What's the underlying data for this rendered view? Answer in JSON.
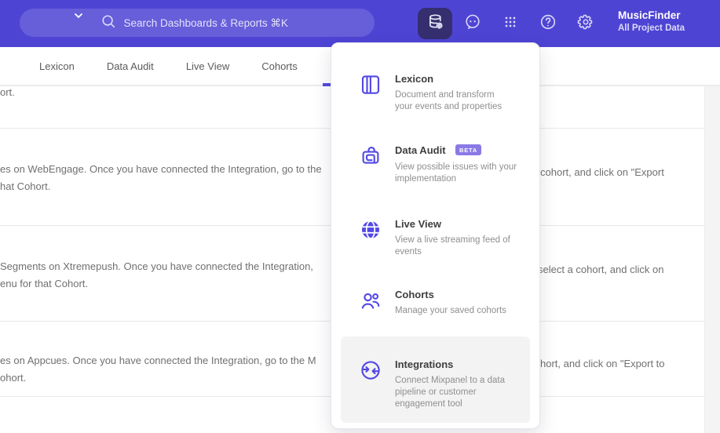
{
  "topbar": {
    "search_placeholder": "Search Dashboards & Reports ⌘K",
    "project_name": "MusicFinder",
    "project_subtitle": "All Project Data"
  },
  "tabs": {
    "items": [
      {
        "label": "Lexicon"
      },
      {
        "label": "Data Audit"
      },
      {
        "label": "Live View"
      },
      {
        "label": "Cohorts"
      }
    ]
  },
  "menu": {
    "items": [
      {
        "title": "Lexicon",
        "description": "Document and transform\nyour events and properties"
      },
      {
        "title": "Data Audit",
        "badge": "BETA",
        "description": "View possible issues with your\nimplementation"
      },
      {
        "title": "Live View",
        "description": "View a live streaming feed of\nevents"
      },
      {
        "title": "Cohorts",
        "description": "Manage your saved cohorts"
      },
      {
        "title": "Integrations",
        "description": "Connect Mixpanel to a data\npipeline or customer\nengagement tool"
      }
    ]
  },
  "content": {
    "rows": [
      {
        "left": "ort.",
        "right": ""
      },
      {
        "left": "es on WebEngage. Once you have connected the Integration, go to the\nhat Cohort.",
        "right": "cohort, and click on \"Export"
      },
      {
        "left": "Segments on Xtremepush. Once you have connected the Integration,\nenu for that Cohort.",
        "right": "select a cohort, and click on"
      },
      {
        "left": "es on Appcues. Once you have connected the Integration, go to the M\nohort.",
        "right": "hort, and click on \"Export to"
      }
    ]
  },
  "colors": {
    "topbar_bg": "#4E44D4",
    "active_button_bg": "#352F6F",
    "accent": "#5348E4",
    "badge_bg": "#8A7AE6",
    "hover_panel_bg": "#F3F3F4"
  }
}
